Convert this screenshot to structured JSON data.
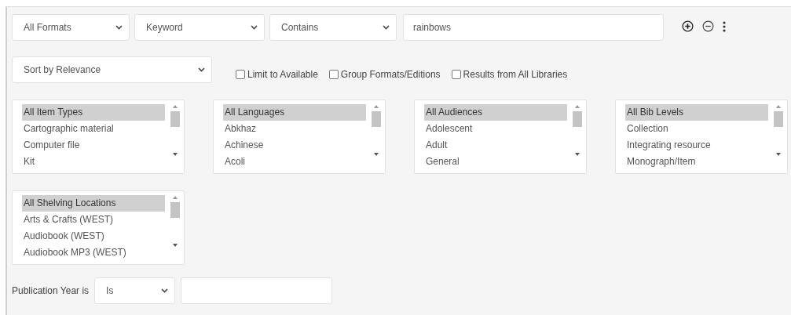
{
  "search_row": {
    "format_select": "All Formats",
    "field_select": "Keyword",
    "operator_select": "Contains",
    "query": "rainbows"
  },
  "sort_select": "Sort by Relevance",
  "checkboxes": [
    {
      "label": "Limit to Available",
      "checked": false
    },
    {
      "label": "Group Formats/Editions",
      "checked": false
    },
    {
      "label": "Results from All Libraries",
      "checked": false
    }
  ],
  "listboxes": [
    {
      "items": [
        {
          "label": "All Item Types",
          "selected": true
        },
        {
          "label": "Cartographic material",
          "selected": false
        },
        {
          "label": "Computer file",
          "selected": false
        },
        {
          "label": "Kit",
          "selected": false
        }
      ]
    },
    {
      "items": [
        {
          "label": "All Languages",
          "selected": true
        },
        {
          "label": "Abkhaz",
          "selected": false
        },
        {
          "label": "Achinese",
          "selected": false
        },
        {
          "label": "Acoli",
          "selected": false
        }
      ]
    },
    {
      "items": [
        {
          "label": "All Audiences",
          "selected": true
        },
        {
          "label": "Adolescent",
          "selected": false
        },
        {
          "label": "Adult",
          "selected": false
        },
        {
          "label": "General",
          "selected": false
        }
      ]
    },
    {
      "items": [
        {
          "label": "All Bib Levels",
          "selected": true
        },
        {
          "label": "Collection",
          "selected": false
        },
        {
          "label": "Integrating resource",
          "selected": false
        },
        {
          "label": "Monograph/Item",
          "selected": false
        }
      ]
    },
    {
      "items": [
        {
          "label": "All Shelving Locations",
          "selected": true
        },
        {
          "label": "Arts & Crafts (WEST)",
          "selected": false
        },
        {
          "label": "Audiobook (WEST)",
          "selected": false
        },
        {
          "label": "Audiobook MP3 (WEST)",
          "selected": false
        }
      ]
    }
  ],
  "publication_year": {
    "label": "Publication Year is",
    "operator_select": "Is"
  }
}
